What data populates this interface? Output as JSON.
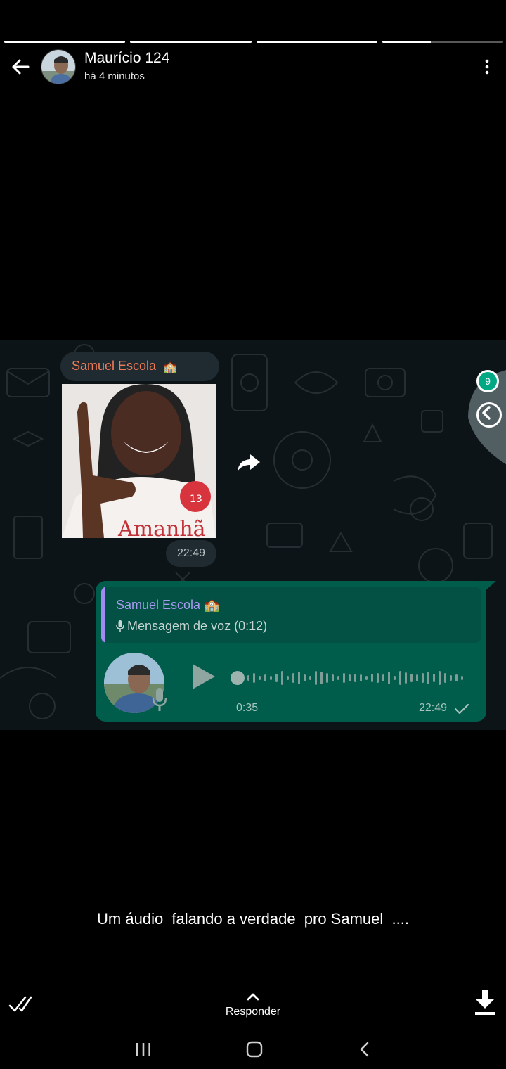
{
  "status": {
    "segments_total": 4,
    "segment_progress": [
      1,
      1,
      1,
      0.4
    ]
  },
  "header": {
    "contact_name": "Maurício 124",
    "posted_time": "há 4 minutos"
  },
  "screenshot": {
    "sender_name": "Samuel Escola",
    "sender_emoji": "🏫",
    "photo_time": "22:49",
    "unread_count": "9",
    "quote_name": "Samuel Escola 🏫",
    "quote_text": "Mensagem de voz (0:12)",
    "voice_duration": "0:35",
    "voice_time": "22:49"
  },
  "caption": "Um áudio  falando a verdade  pro Samuel  ....",
  "footer": {
    "reply_label": "Responder"
  },
  "colors": {
    "chat_bg": "#0d1418",
    "bubble_out": "#005c4b",
    "accent_green": "#00a884",
    "sender_orange": "#f07b58",
    "quote_purple": "#a79bf0"
  }
}
